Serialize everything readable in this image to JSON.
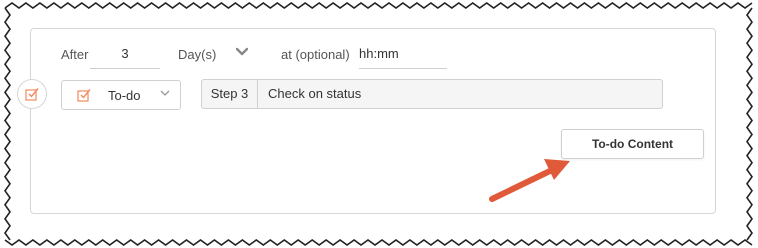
{
  "schedule": {
    "after_label": "After",
    "after_value": "3",
    "unit_value": "Day(s)",
    "at_label": "at (optional)",
    "time_placeholder": "hh:mm"
  },
  "task": {
    "type_value": "To-do",
    "step_label": "Step 3",
    "step_name": "Check on status",
    "content_button": "To-do Content"
  },
  "colors": {
    "accent_orange": "#f08a5d",
    "annotation_arrow": "#e05a3a",
    "border": "#d6d6d6"
  },
  "icons": {
    "todo_checkbox": "checkbox-icon",
    "dropdown": "chevron-down-icon"
  }
}
